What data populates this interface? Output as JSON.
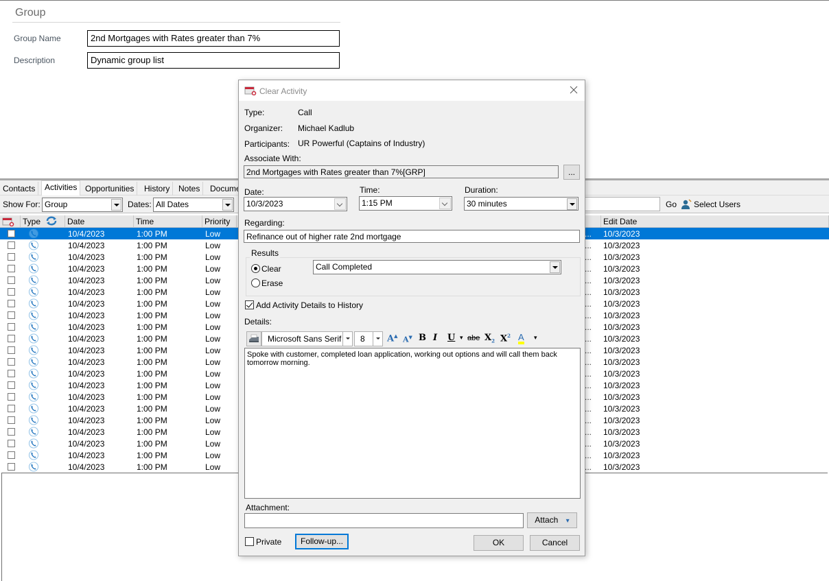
{
  "group": {
    "title": "Group",
    "name_label": "Group Name",
    "name_value": "2nd Mortgages with Rates greater than 7%",
    "description_label": "Description",
    "description_value": "Dynamic group list"
  },
  "tabs": [
    {
      "label": "Contacts",
      "active": false
    },
    {
      "label": "Activities",
      "active": true
    },
    {
      "label": "Opportunities",
      "active": false
    },
    {
      "label": "History",
      "active": false
    },
    {
      "label": "Notes",
      "active": false
    },
    {
      "label": "Documents",
      "active": false
    }
  ],
  "filters": {
    "show_for_label": "Show For:",
    "show_for_value": "Group",
    "dates_label": "Dates:",
    "dates_value": "All Dates",
    "search_value": "",
    "go_label": "Go",
    "select_users_label": "Select Users"
  },
  "grid": {
    "columns": [
      "Type",
      "Date",
      "Time",
      "Priority",
      "Edit Date"
    ],
    "rows": [
      {
        "date": "10/4/2023",
        "time": "1:00 PM",
        "priority": "Low",
        "edit_date": "10/3/2023",
        "selected": true
      },
      {
        "date": "10/4/2023",
        "time": "1:00 PM",
        "priority": "Low",
        "edit_date": "10/3/2023"
      },
      {
        "date": "10/4/2023",
        "time": "1:00 PM",
        "priority": "Low",
        "edit_date": "10/3/2023"
      },
      {
        "date": "10/4/2023",
        "time": "1:00 PM",
        "priority": "Low",
        "edit_date": "10/3/2023"
      },
      {
        "date": "10/4/2023",
        "time": "1:00 PM",
        "priority": "Low",
        "edit_date": "10/3/2023"
      },
      {
        "date": "10/4/2023",
        "time": "1:00 PM",
        "priority": "Low",
        "edit_date": "10/3/2023"
      },
      {
        "date": "10/4/2023",
        "time": "1:00 PM",
        "priority": "Low",
        "edit_date": "10/3/2023"
      },
      {
        "date": "10/4/2023",
        "time": "1:00 PM",
        "priority": "Low",
        "edit_date": "10/3/2023"
      },
      {
        "date": "10/4/2023",
        "time": "1:00 PM",
        "priority": "Low",
        "edit_date": "10/3/2023"
      },
      {
        "date": "10/4/2023",
        "time": "1:00 PM",
        "priority": "Low",
        "edit_date": "10/3/2023"
      },
      {
        "date": "10/4/2023",
        "time": "1:00 PM",
        "priority": "Low",
        "edit_date": "10/3/2023"
      },
      {
        "date": "10/4/2023",
        "time": "1:00 PM",
        "priority": "Low",
        "edit_date": "10/3/2023"
      },
      {
        "date": "10/4/2023",
        "time": "1:00 PM",
        "priority": "Low",
        "edit_date": "10/3/2023"
      },
      {
        "date": "10/4/2023",
        "time": "1:00 PM",
        "priority": "Low",
        "edit_date": "10/3/2023"
      },
      {
        "date": "10/4/2023",
        "time": "1:00 PM",
        "priority": "Low",
        "edit_date": "10/3/2023"
      },
      {
        "date": "10/4/2023",
        "time": "1:00 PM",
        "priority": "Low",
        "edit_date": "10/3/2023"
      },
      {
        "date": "10/4/2023",
        "time": "1:00 PM",
        "priority": "Low",
        "edit_date": "10/3/2023"
      },
      {
        "date": "10/4/2023",
        "time": "1:00 PM",
        "priority": "Low",
        "edit_date": "10/3/2023"
      },
      {
        "date": "10/4/2023",
        "time": "1:00 PM",
        "priority": "Low",
        "edit_date": "10/3/2023"
      },
      {
        "date": "10/4/2023",
        "time": "1:00 PM",
        "priority": "Low",
        "edit_date": "10/3/2023"
      },
      {
        "date": "10/4/2023",
        "time": "1:00 PM",
        "priority": "Low",
        "edit_date": "10/3/2023"
      }
    ],
    "truncated_marker": "..."
  },
  "dialog": {
    "title": "Clear Activity",
    "type_label": "Type:",
    "type_value": "Call",
    "organizer_label": "Organizer:",
    "organizer_value": "Michael Kadlub",
    "participants_label": "Participants:",
    "participants_value": "UR Powerful (Captains of Industry)",
    "associate_label": "Associate With:",
    "associate_value": "2nd Mortgages with Rates greater than 7%[GRP]",
    "associate_button": "...",
    "date_label": "Date:",
    "date_value": "10/3/2023",
    "time_label": "Time:",
    "time_value": "1:15 PM",
    "duration_label": "Duration:",
    "duration_value": "30 minutes",
    "regarding_label": "Regarding:",
    "regarding_value": "Refinance out of higher rate 2nd mortgage",
    "results_label": "Results",
    "clear_label": "Clear",
    "erase_label": "Erase",
    "result_value": "Call Completed",
    "add_history_label": "Add Activity Details to History",
    "add_history_checked": true,
    "details_label": "Details:",
    "font_name": "Microsoft Sans Serif",
    "font_size": "8",
    "details_text": "Spoke with customer, completed loan application, working out options and will call them back tomorrow morning.",
    "attachment_label": "Attachment:",
    "attachment_value": "",
    "attach_button": "Attach",
    "private_label": "Private",
    "followup_button": "Follow-up...",
    "ok_button": "OK",
    "cancel_button": "Cancel"
  },
  "colors": {
    "selection": "#0078d7",
    "phone_icon": "#1e73be",
    "highlight_underline": "#ffff00"
  }
}
